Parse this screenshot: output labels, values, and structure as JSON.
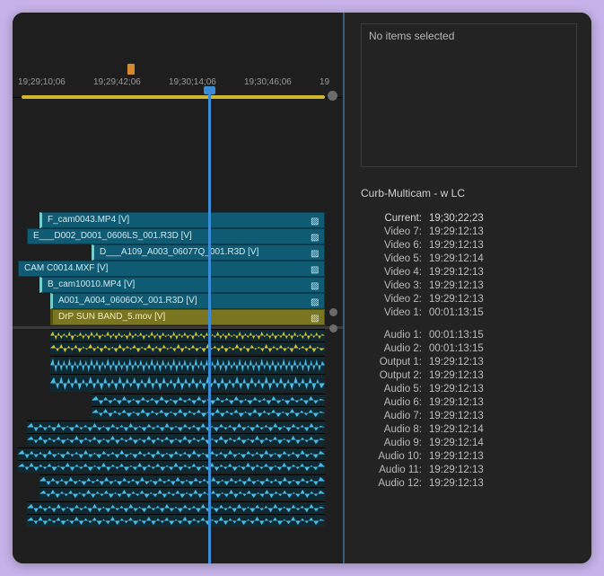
{
  "ruler": {
    "ticks": [
      "19;29;10;06",
      "19;29;42;06",
      "19;30;14;06",
      "19;30;46;06",
      "19"
    ]
  },
  "clips": {
    "v7": "F_cam0043.MP4 [V]",
    "v6": "E___D002_D001_0606LS_001.R3D [V]",
    "v5": "D___A109_A003_06077Q_001.R3D [V]",
    "v4": "CAM C0014.MXF [V]",
    "v3": "B_cam10010.MP4 [V]",
    "v2": "A001_A004_0606OX_001.R3D [V]",
    "v1": "DrP SUN BAND_5.mov [V]"
  },
  "info": {
    "selection": "No items selected",
    "source_title": "Curb-Multicam - w LC",
    "current_label": "Current:",
    "current_value": "19;30;22;23",
    "video": [
      {
        "label": "Video 7:",
        "value": "19:29:12:13"
      },
      {
        "label": "Video 6:",
        "value": "19:29:12:13"
      },
      {
        "label": "Video 5:",
        "value": "19:29:12:14"
      },
      {
        "label": "Video 4:",
        "value": "19:29:12:13"
      },
      {
        "label": "Video 3:",
        "value": "19:29:12:13"
      },
      {
        "label": "Video 2:",
        "value": "19:29:12:13"
      },
      {
        "label": "Video 1:",
        "value": "00:01:13:15"
      }
    ],
    "audio": [
      {
        "label": "Audio 1:",
        "value": "00:01:13:15"
      },
      {
        "label": "Audio 2:",
        "value": "00:01:13:15"
      },
      {
        "label": "Output 1:",
        "value": "19:29:12:13"
      },
      {
        "label": "Output 2:",
        "value": "19:29:12:13"
      },
      {
        "label": "Audio 5:",
        "value": "19:29:12:13"
      },
      {
        "label": "Audio 6:",
        "value": "19:29:12:13"
      },
      {
        "label": "Audio 7:",
        "value": "19:29:12:13"
      },
      {
        "label": "Audio 8:",
        "value": "19:29:12:14"
      },
      {
        "label": "Audio 9:",
        "value": "19:29:12:14"
      },
      {
        "label": "Audio 10:",
        "value": "19:29:12:13"
      },
      {
        "label": "Audio 11:",
        "value": "19:29:12:13"
      },
      {
        "label": "Audio 12:",
        "value": "19:29:12:13"
      }
    ]
  }
}
